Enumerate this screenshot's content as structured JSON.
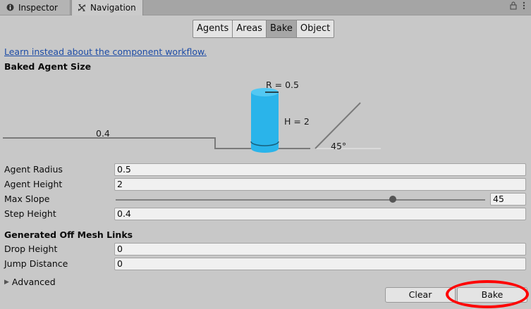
{
  "tabs": {
    "inspector": {
      "label": "Inspector",
      "icon": "info-icon"
    },
    "navigation": {
      "label": "Navigation",
      "icon": "navigation-icon"
    }
  },
  "toolbar_icons": [
    "lock-icon",
    "menu-icon"
  ],
  "segments": [
    "Agents",
    "Areas",
    "Bake",
    "Object"
  ],
  "active_segment": "Bake",
  "link_text": "Learn instead about the component workflow.",
  "baked_agent_size": {
    "title": "Baked Agent Size",
    "radius_label": "R = 0.5",
    "height_label": "H = 2",
    "step_label": "0.4",
    "slope_label": "45°",
    "cylinder_color": "#2ab4ea"
  },
  "fields": {
    "agent_radius": {
      "label": "Agent Radius",
      "value": "0.5"
    },
    "agent_height": {
      "label": "Agent Height",
      "value": "2"
    },
    "max_slope": {
      "label": "Max Slope",
      "value": "45",
      "slider_fraction": 0.75
    },
    "step_height": {
      "label": "Step Height",
      "value": "0.4"
    }
  },
  "off_mesh": {
    "title": "Generated Off Mesh Links",
    "drop_height": {
      "label": "Drop Height",
      "value": "0"
    },
    "jump_distance": {
      "label": "Jump Distance",
      "value": "0"
    }
  },
  "advanced_label": "Advanced",
  "buttons": {
    "clear": "Clear",
    "bake": "Bake"
  },
  "highlight_color": "#ff0000"
}
